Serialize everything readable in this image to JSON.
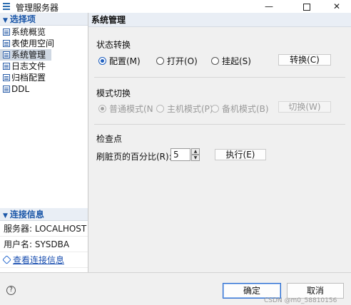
{
  "window": {
    "title": "管理服务器",
    "min_glyph": "—",
    "close_glyph": "✕"
  },
  "left": {
    "section_title": "选择项",
    "items": [
      {
        "label": "系统概览"
      },
      {
        "label": "表使用空间"
      },
      {
        "label": "系统管理",
        "selected": true
      },
      {
        "label": "日志文件"
      },
      {
        "label": "归档配置"
      },
      {
        "label": "DDL"
      }
    ],
    "connection": {
      "title": "连接信息",
      "server": "服务器: LOCALHOST",
      "user": "用户名: SYSDBA",
      "view_link": "查看连接信息"
    }
  },
  "right": {
    "title": "系统管理",
    "state": {
      "title": "状态转换",
      "options": [
        "配置(M)",
        "打开(O)",
        "挂起(S)"
      ],
      "selected": "配置(M)",
      "button": "转换(C)"
    },
    "mode": {
      "title": "模式切换",
      "options": [
        "普通模式(N",
        "主机模式(P)",
        "备机模式(B)"
      ],
      "selected": "普通模式(N",
      "button": "切换(W)",
      "disabled": true
    },
    "checkpoint": {
      "title": "检查点",
      "label": "刷脏页的百分比(R):",
      "value": "5",
      "button": "执行(E)"
    }
  },
  "footer": {
    "help_glyph": "?",
    "ok": "确定",
    "cancel": "取消",
    "watermark": "CSDN @m0_58810156"
  },
  "colors": {
    "accent": "#1a56a8",
    "selection": "#cfd8e3",
    "link": "#1a4fb0"
  }
}
